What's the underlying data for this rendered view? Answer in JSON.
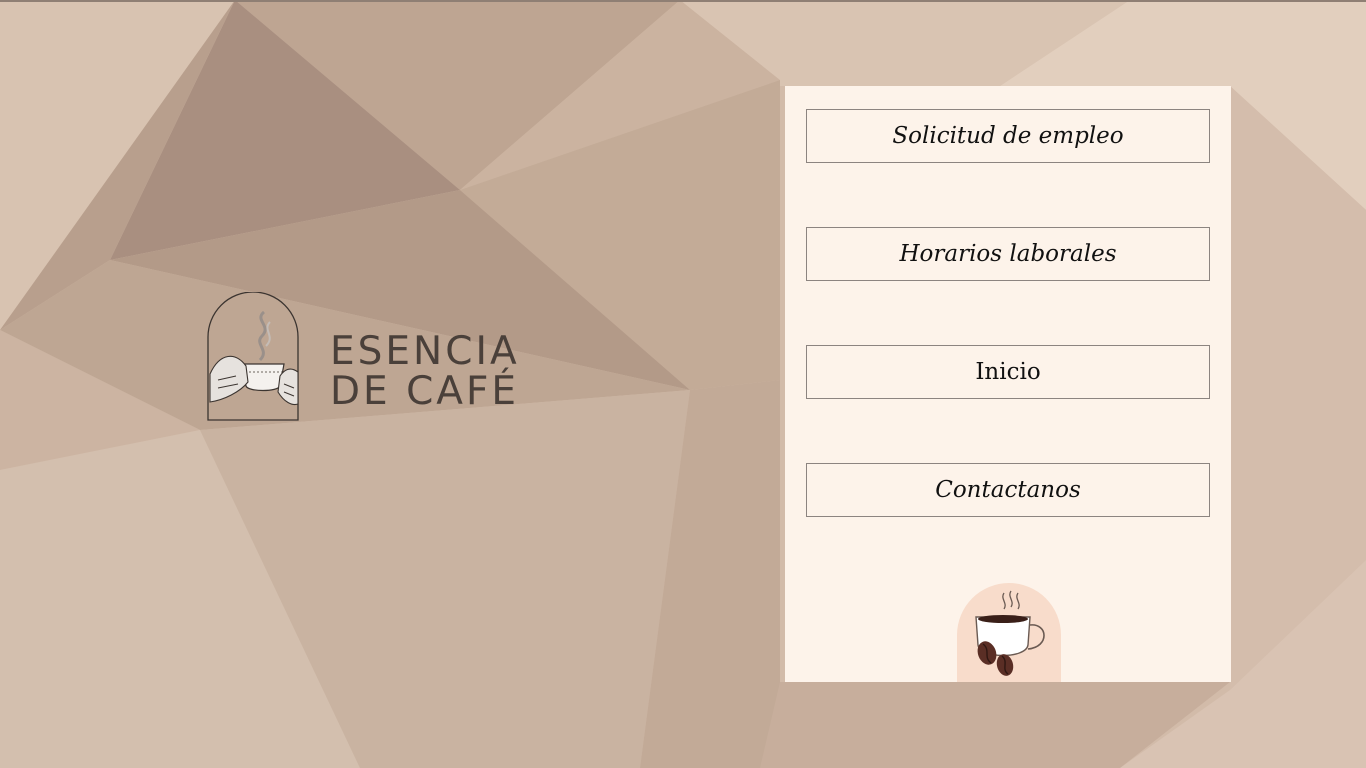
{
  "brand": {
    "line1": "ESENCIA",
    "line2": "DE CAFÉ",
    "emblem_icon": "hands-holding-coffee-cup-icon"
  },
  "nav": {
    "items": [
      {
        "label": "Solicitud de empleo",
        "italic": true
      },
      {
        "label": "Horarios laborales",
        "italic": true
      },
      {
        "label": "Inicio",
        "italic": false
      },
      {
        "label": "Contactanos",
        "italic": true
      }
    ]
  },
  "decoration": {
    "cup_icon": "coffee-cup-with-beans-icon"
  },
  "colors": {
    "background": "#d2bba9",
    "panel": "#fdf3ea",
    "button_border": "#8c8480",
    "logo_text": "#4a403a",
    "cup_circle": "#f8dccb",
    "bean": "#5a2e25"
  }
}
